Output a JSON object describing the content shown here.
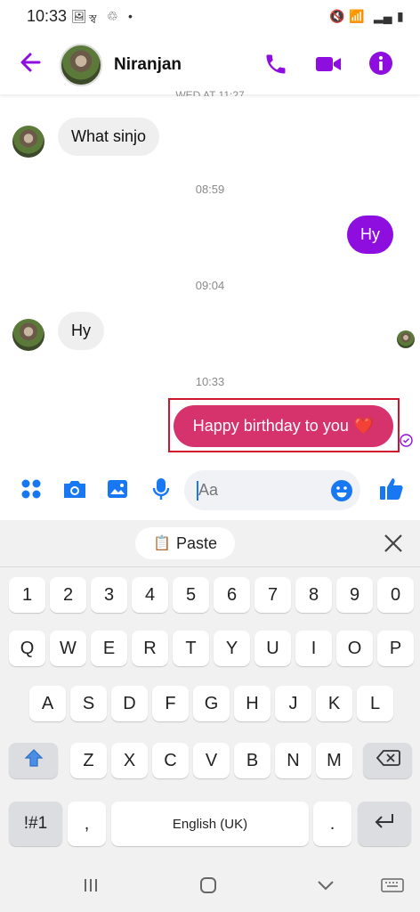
{
  "status_bar": {
    "time": "10:33",
    "signal_text": "স্ব",
    "dot": "•"
  },
  "header": {
    "contact_name": "Niranjan"
  },
  "chat": {
    "partial_timestamp": "WED AT 11:27",
    "messages": [
      {
        "from": "them",
        "text": "What sinjo"
      },
      {
        "timestamp": "08:59"
      },
      {
        "from": "me",
        "text": "Hy"
      },
      {
        "timestamp": "09:04"
      },
      {
        "from": "them",
        "text": "Hy"
      },
      {
        "timestamp": "10:33"
      },
      {
        "from": "me",
        "text": "Happy birthday to you",
        "emoji": "❤️"
      }
    ],
    "accent_color": "#8e0ee0",
    "sent_highlight_color": "#d6336c"
  },
  "composer": {
    "placeholder": "Aa"
  },
  "keyboard": {
    "paste_label": "Paste",
    "row_numbers": [
      "1",
      "2",
      "3",
      "4",
      "5",
      "6",
      "7",
      "8",
      "9",
      "0"
    ],
    "row_q": [
      "Q",
      "W",
      "E",
      "R",
      "T",
      "Y",
      "U",
      "I",
      "O",
      "P"
    ],
    "row_a": [
      "A",
      "S",
      "D",
      "F",
      "G",
      "H",
      "J",
      "K",
      "L"
    ],
    "row_z": [
      "Z",
      "X",
      "C",
      "V",
      "B",
      "N",
      "M"
    ],
    "symbols_label": "!#1",
    "comma_label": ",",
    "space_label": "English (UK)",
    "period_label": "."
  }
}
